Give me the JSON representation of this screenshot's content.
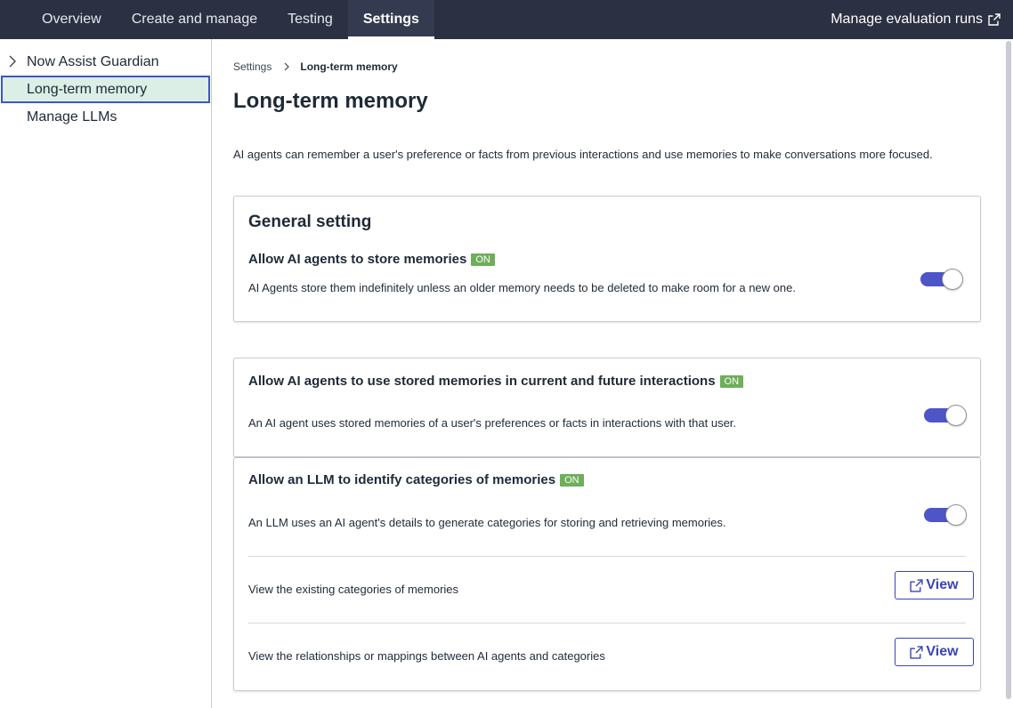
{
  "nav": {
    "tabs": [
      {
        "label": "Overview"
      },
      {
        "label": "Create and manage"
      },
      {
        "label": "Testing"
      },
      {
        "label": "Settings"
      }
    ],
    "manage_runs": "Manage evaluation runs"
  },
  "sidebar": {
    "items": [
      {
        "label": "Now Assist Guardian"
      },
      {
        "label": "Long-term memory"
      },
      {
        "label": "Manage LLMs"
      }
    ]
  },
  "breadcrumb": {
    "root": "Settings",
    "current": "Long-term memory"
  },
  "page": {
    "title": "Long-term memory",
    "intro": "AI agents can remember a user's preference or facts from previous interactions and use memories to make conversations more focused."
  },
  "general": {
    "heading": "General setting",
    "store": {
      "title": "Allow AI agents to store memories",
      "badge": "ON",
      "desc": "AI Agents store them indefinitely unless an older memory needs to be deleted to make room for a new one.",
      "enabled": true
    }
  },
  "use_memories": {
    "title": "Allow AI agents to use stored memories in current and future interactions",
    "badge": "ON",
    "desc": "An AI agent uses stored memories of a user's preferences or facts in interactions with that user.",
    "enabled": true
  },
  "categories": {
    "title": "Allow an LLM to identify categories of memories",
    "badge": "ON",
    "desc": "An LLM uses an AI agent's details to generate categories for storing and retrieving memories.",
    "enabled": true,
    "rows": [
      {
        "text": "View the existing categories of memories",
        "button": "View"
      },
      {
        "text": "View the relationships or mappings between AI agents and categories",
        "button": "View"
      }
    ]
  },
  "colors": {
    "topbar": "#2b3042",
    "accent": "#4d55c7",
    "on_badge": "#6fae5a",
    "selected_bg": "#dcefe6"
  }
}
